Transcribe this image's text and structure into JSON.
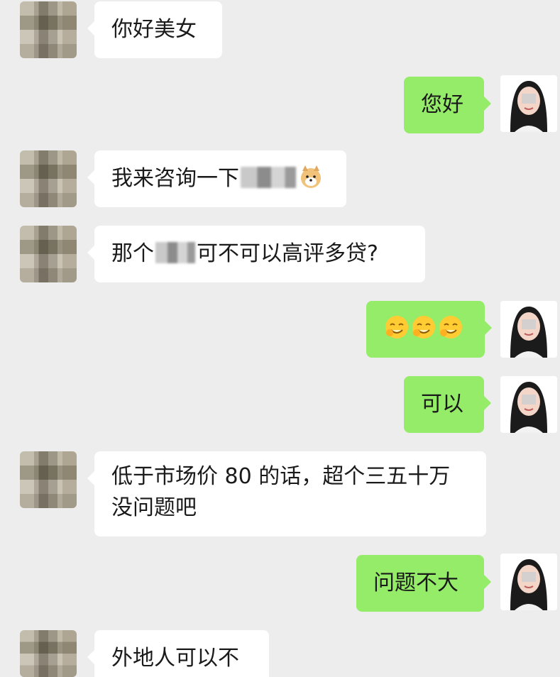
{
  "messages": [
    {
      "side": "in",
      "text": "你好美女"
    },
    {
      "side": "out",
      "text": "您好"
    },
    {
      "side": "in",
      "text": "我来咨询一下"
    },
    {
      "side": "in",
      "text_before": "那个",
      "text_after": "可不可以高评多贷?"
    },
    {
      "side": "out",
      "emoji_icon": "laughing-face-emoji"
    },
    {
      "side": "out",
      "text": "可以"
    },
    {
      "side": "in",
      "line1": "低于市场价 80 的话，超个三五十万",
      "line2": "没问题吧"
    },
    {
      "side": "out",
      "text": "问题不大"
    },
    {
      "side": "in",
      "text": "外地人可以不"
    }
  ],
  "icons": {
    "incoming_avatar": "blurred-avatar-icon",
    "outgoing_avatar": "woman-avatar-icon",
    "doge": "doge-emoji-icon"
  },
  "colors": {
    "background": "#ededed",
    "incoming_bubble": "#ffffff",
    "outgoing_bubble": "#95ec69"
  }
}
